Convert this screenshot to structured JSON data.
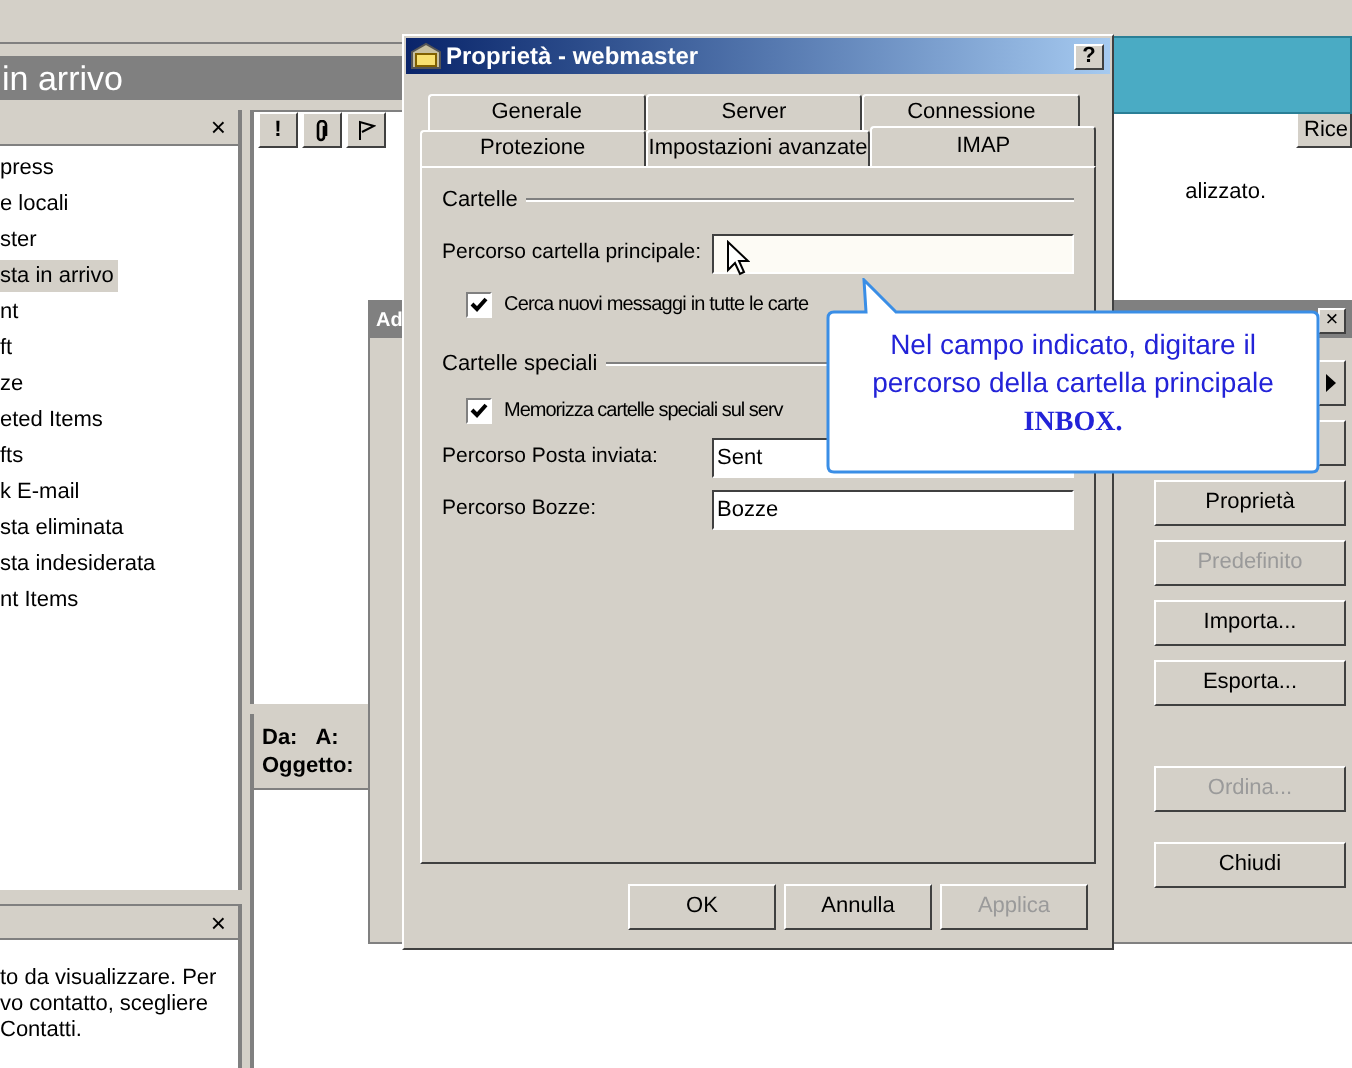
{
  "main_window": {
    "title": "in arrivo"
  },
  "folder_pane": {
    "close": "×",
    "items": [
      {
        "label": "press",
        "selected": false
      },
      {
        "label": "e locali",
        "selected": false
      },
      {
        "label": "ster",
        "selected": false
      },
      {
        "label": "sta in arrivo",
        "selected": true
      },
      {
        "label": "nt",
        "selected": false
      },
      {
        "label": "ft",
        "selected": false
      },
      {
        "label": "ze",
        "selected": false
      },
      {
        "label": "eted Items",
        "selected": false
      },
      {
        "label": "fts",
        "selected": false
      },
      {
        "label": "k E-mail",
        "selected": false
      },
      {
        "label": "sta eliminata",
        "selected": false
      },
      {
        "label": "sta indesiderata",
        "selected": false
      },
      {
        "label": "nt Items",
        "selected": false
      }
    ]
  },
  "message_list": {
    "columns": [
      {
        "kind": "text",
        "label": "!"
      },
      {
        "kind": "clip"
      },
      {
        "kind": "flag"
      }
    ],
    "last_column": "Rice",
    "message": "alizzato."
  },
  "preview": {
    "from": "Da:",
    "to": "A:",
    "subject": "Oggetto:"
  },
  "contacts_pane": {
    "close": "×",
    "lines": [
      "to da visualizzare. Per",
      "vo contatto, scegliere",
      "Contatti."
    ]
  },
  "back_dialog": {
    "title": "Ad",
    "close": "×",
    "buttons": [
      {
        "label": "Proprietà",
        "disabled": false
      },
      {
        "label": "Predefinito",
        "disabled": true
      },
      {
        "label": "Importa...",
        "disabled": false
      },
      {
        "label": "Esporta...",
        "disabled": false
      },
      {
        "label": "Ordina...",
        "disabled": true
      },
      {
        "label": "Chiudi",
        "disabled": false
      }
    ]
  },
  "dialog": {
    "title": "Proprietà - webmaster",
    "help": "?",
    "tab_rows": [
      [
        {
          "label": "Generale",
          "selected": false
        },
        {
          "label": "Server",
          "selected": false
        },
        {
          "label": "Connessione",
          "selected": false
        }
      ],
      [
        {
          "label": "Protezione",
          "selected": false
        },
        {
          "label": "Impostazioni avanzate",
          "selected": false
        },
        {
          "label": "IMAP",
          "selected": true
        }
      ]
    ],
    "folders": {
      "heading": "Cartelle",
      "root_label": "Percorso cartella principale:",
      "check": {
        "label": "Cerca nuovi messaggi in tutte le carte",
        "checked": true
      }
    },
    "special": {
      "heading": "Cartelle speciali",
      "check": {
        "label": "Memorizza cartelle speciali sul serv",
        "checked": true
      },
      "fields": [
        {
          "label": "Percorso Posta inviata:",
          "value": "Sent"
        },
        {
          "label": "Percorso Bozze:",
          "value": "Bozze"
        }
      ]
    },
    "buttons": [
      {
        "label": "OK",
        "disabled": false
      },
      {
        "label": "Annulla",
        "disabled": false
      },
      {
        "label": "Applica",
        "disabled": true
      }
    ]
  },
  "callout": {
    "lines": [
      "Nel campo indicato, digitare il",
      "percorso della cartella principale",
      "**INBOX.**"
    ]
  }
}
